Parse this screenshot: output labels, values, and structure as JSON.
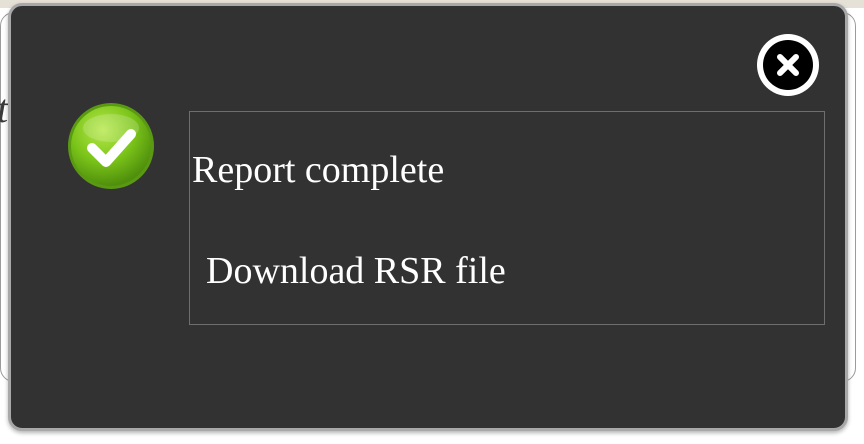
{
  "background": {
    "partial_text": "t"
  },
  "dialog": {
    "title": "Report complete",
    "link_label": "Download RSR file",
    "status_icon": "check-icon",
    "close_icon": "close-icon",
    "colors": {
      "dialog_bg": "#323232",
      "dialog_border": "#a8a8a8",
      "success_green": "#7cc51a",
      "text": "#ffffff"
    }
  }
}
